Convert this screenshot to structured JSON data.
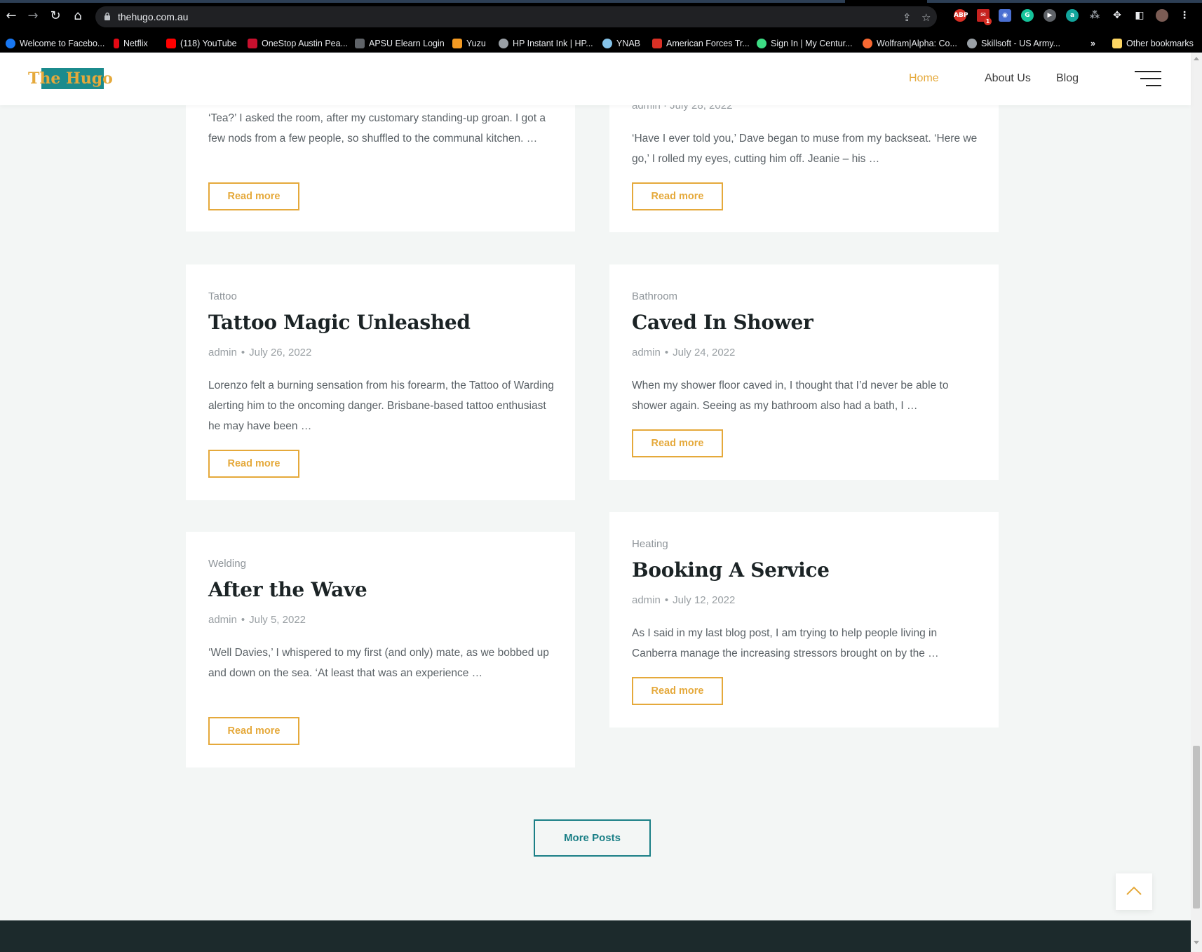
{
  "browser": {
    "url": "thehugo.com.au",
    "bookmarks": [
      {
        "label": "Welcome to Facebo...",
        "color": "#1877f2"
      },
      {
        "label": "Netflix",
        "color": "#e50914"
      },
      {
        "label": "(118) YouTube",
        "color": "#ff0000"
      },
      {
        "label": "OneStop Austin Pea...",
        "color": "#c8102e"
      },
      {
        "label": "APSU Elearn Login",
        "color": "#8a8d91"
      },
      {
        "label": "Yuzu",
        "color": "#f59b23"
      },
      {
        "label": "HP Instant Ink | HP...",
        "color": "#9aa0a6"
      },
      {
        "label": "YNAB",
        "color": "#85c3e9"
      },
      {
        "label": "American Forces Tr...",
        "color": "#d93025"
      },
      {
        "label": "Sign In | My Centur...",
        "color": "#3ddc84"
      },
      {
        "label": "Wolfram|Alpha: Co...",
        "color": "#f96932"
      },
      {
        "label": "Skillsoft - US Army...",
        "color": "#9aa0a6"
      }
    ],
    "overflow_label": "»",
    "other_bookmarks": "Other bookmarks",
    "extension_badge": "1"
  },
  "site": {
    "logo": "The Hugo",
    "nav": [
      {
        "label": "Home",
        "active": true
      },
      {
        "label": "About Us",
        "active": false
      },
      {
        "label": "Blog",
        "active": false
      }
    ]
  },
  "cards_top": [
    {
      "excerpt": "‘Tea?’ I asked the room, after my customary standing-up groan. I got a few nods from a few people, so shuffled to the communal kitchen. …",
      "read_more": "Read more"
    },
    {
      "meta_partial": "admin · July 28, 2022",
      "excerpt": "‘Have I ever told you,’ Dave began to muse from my backseat. ‘Here we go,’ I rolled my eyes, cutting him off. Jeanie – his …",
      "read_more": "Read more"
    }
  ],
  "posts": [
    {
      "category": "Tattoo",
      "title": "Tattoo Magic Unleashed",
      "author": "admin",
      "date": "July 26, 2022",
      "excerpt": "Lorenzo felt a burning sensation from his forearm, the Tattoo of Warding alerting him to the oncoming danger. Brisbane-based tattoo enthusiast he may have been …",
      "read_more": "Read more"
    },
    {
      "category": "Bathroom",
      "title": "Caved In Shower",
      "author": "admin",
      "date": "July 24, 2022",
      "excerpt": "When my shower floor caved in, I thought that I’d never be able to shower again. Seeing as my bathroom also had a bath, I …",
      "read_more": "Read more"
    },
    {
      "category": "Welding",
      "title": "After the Wave",
      "author": "admin",
      "date": "July 5, 2022",
      "excerpt": "‘Well Davies,’ I whispered to my first (and only) mate, as we bobbed up and down on the sea. ‘At least that was an experience …",
      "read_more": "Read more"
    },
    {
      "category": "Heating",
      "title": "Booking A Service",
      "author": "admin",
      "date": "July 12, 2022",
      "excerpt": "As I said in my last blog post, I am trying to help people living in Canberra manage the increasing stressors brought on by the …",
      "read_more": "Read more"
    }
  ],
  "more_posts": "More Posts",
  "colors": {
    "accent": "#e5a93b",
    "teal": "#1a7f86",
    "footer": "#1c2a2c"
  }
}
